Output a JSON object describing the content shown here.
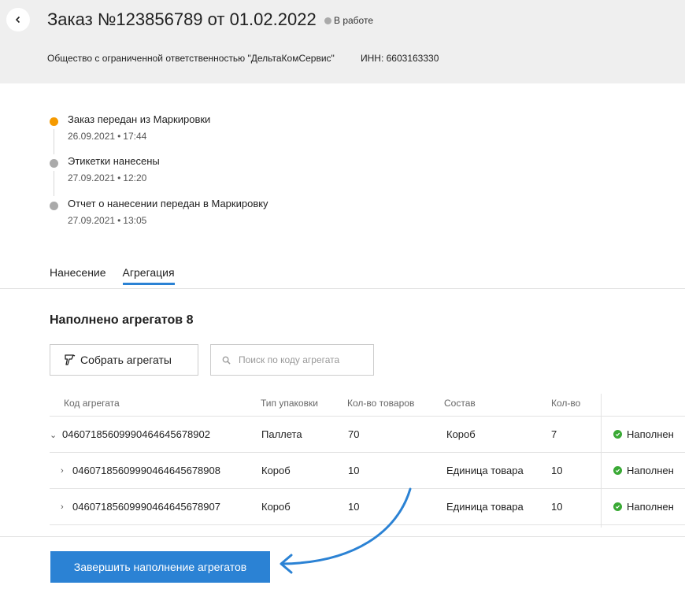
{
  "header": {
    "title": "Заказ №123856789 от 01.02.2022",
    "status": "В работе",
    "status_color": "#aaaaaa",
    "company": "Общество с ограниченной ответственностью \"ДельтаКомСервис\"",
    "inn": "ИНН: 6603163330"
  },
  "timeline": [
    {
      "title": "Заказ передан из Маркировки",
      "date": "26.09.2021",
      "time": "17:44",
      "active": true
    },
    {
      "title": "Этикетки нанесены",
      "date": "27.09.2021",
      "time": "12:20",
      "active": false
    },
    {
      "title": "Отчет о нанесении передан в Маркировку",
      "date": "27.09.2021",
      "time": "13:05",
      "active": false
    }
  ],
  "date_separator": "•",
  "tabs": [
    {
      "label": "Нанесение",
      "active": false
    },
    {
      "label": "Агрегация",
      "active": true
    }
  ],
  "aggregation": {
    "title": "Наполнено агрегатов 8",
    "collect_button": "Собрать агрегаты",
    "search_placeholder": "Поиск по коду агрегата"
  },
  "table": {
    "columns": [
      "Код агрегата",
      "Тип упаковки",
      "Кол-во товаров",
      "Состав",
      "Кол-во"
    ],
    "rows": [
      {
        "code": "04607185609990464645678902",
        "pack": "Паллета",
        "count": "70",
        "content": "Короб",
        "qty": "7",
        "status": "Наполнен",
        "expanded": true
      },
      {
        "code": "04607185609990464645678908",
        "pack": "Короб",
        "count": "10",
        "content": "Единица товара",
        "qty": "10",
        "status": "Наполнен",
        "expanded": false
      },
      {
        "code": "04607185609990464645678907",
        "pack": "Короб",
        "count": "10",
        "content": "Единица товара",
        "qty": "10",
        "status": "Наполнен",
        "expanded": false
      }
    ]
  },
  "footer": {
    "finish_button": "Завершить наполнение агрегатов"
  },
  "colors": {
    "accent": "#2b82d4",
    "timeline_active": "#f59a00",
    "status_ok": "#3aa935",
    "header_bg": "#efefef"
  }
}
